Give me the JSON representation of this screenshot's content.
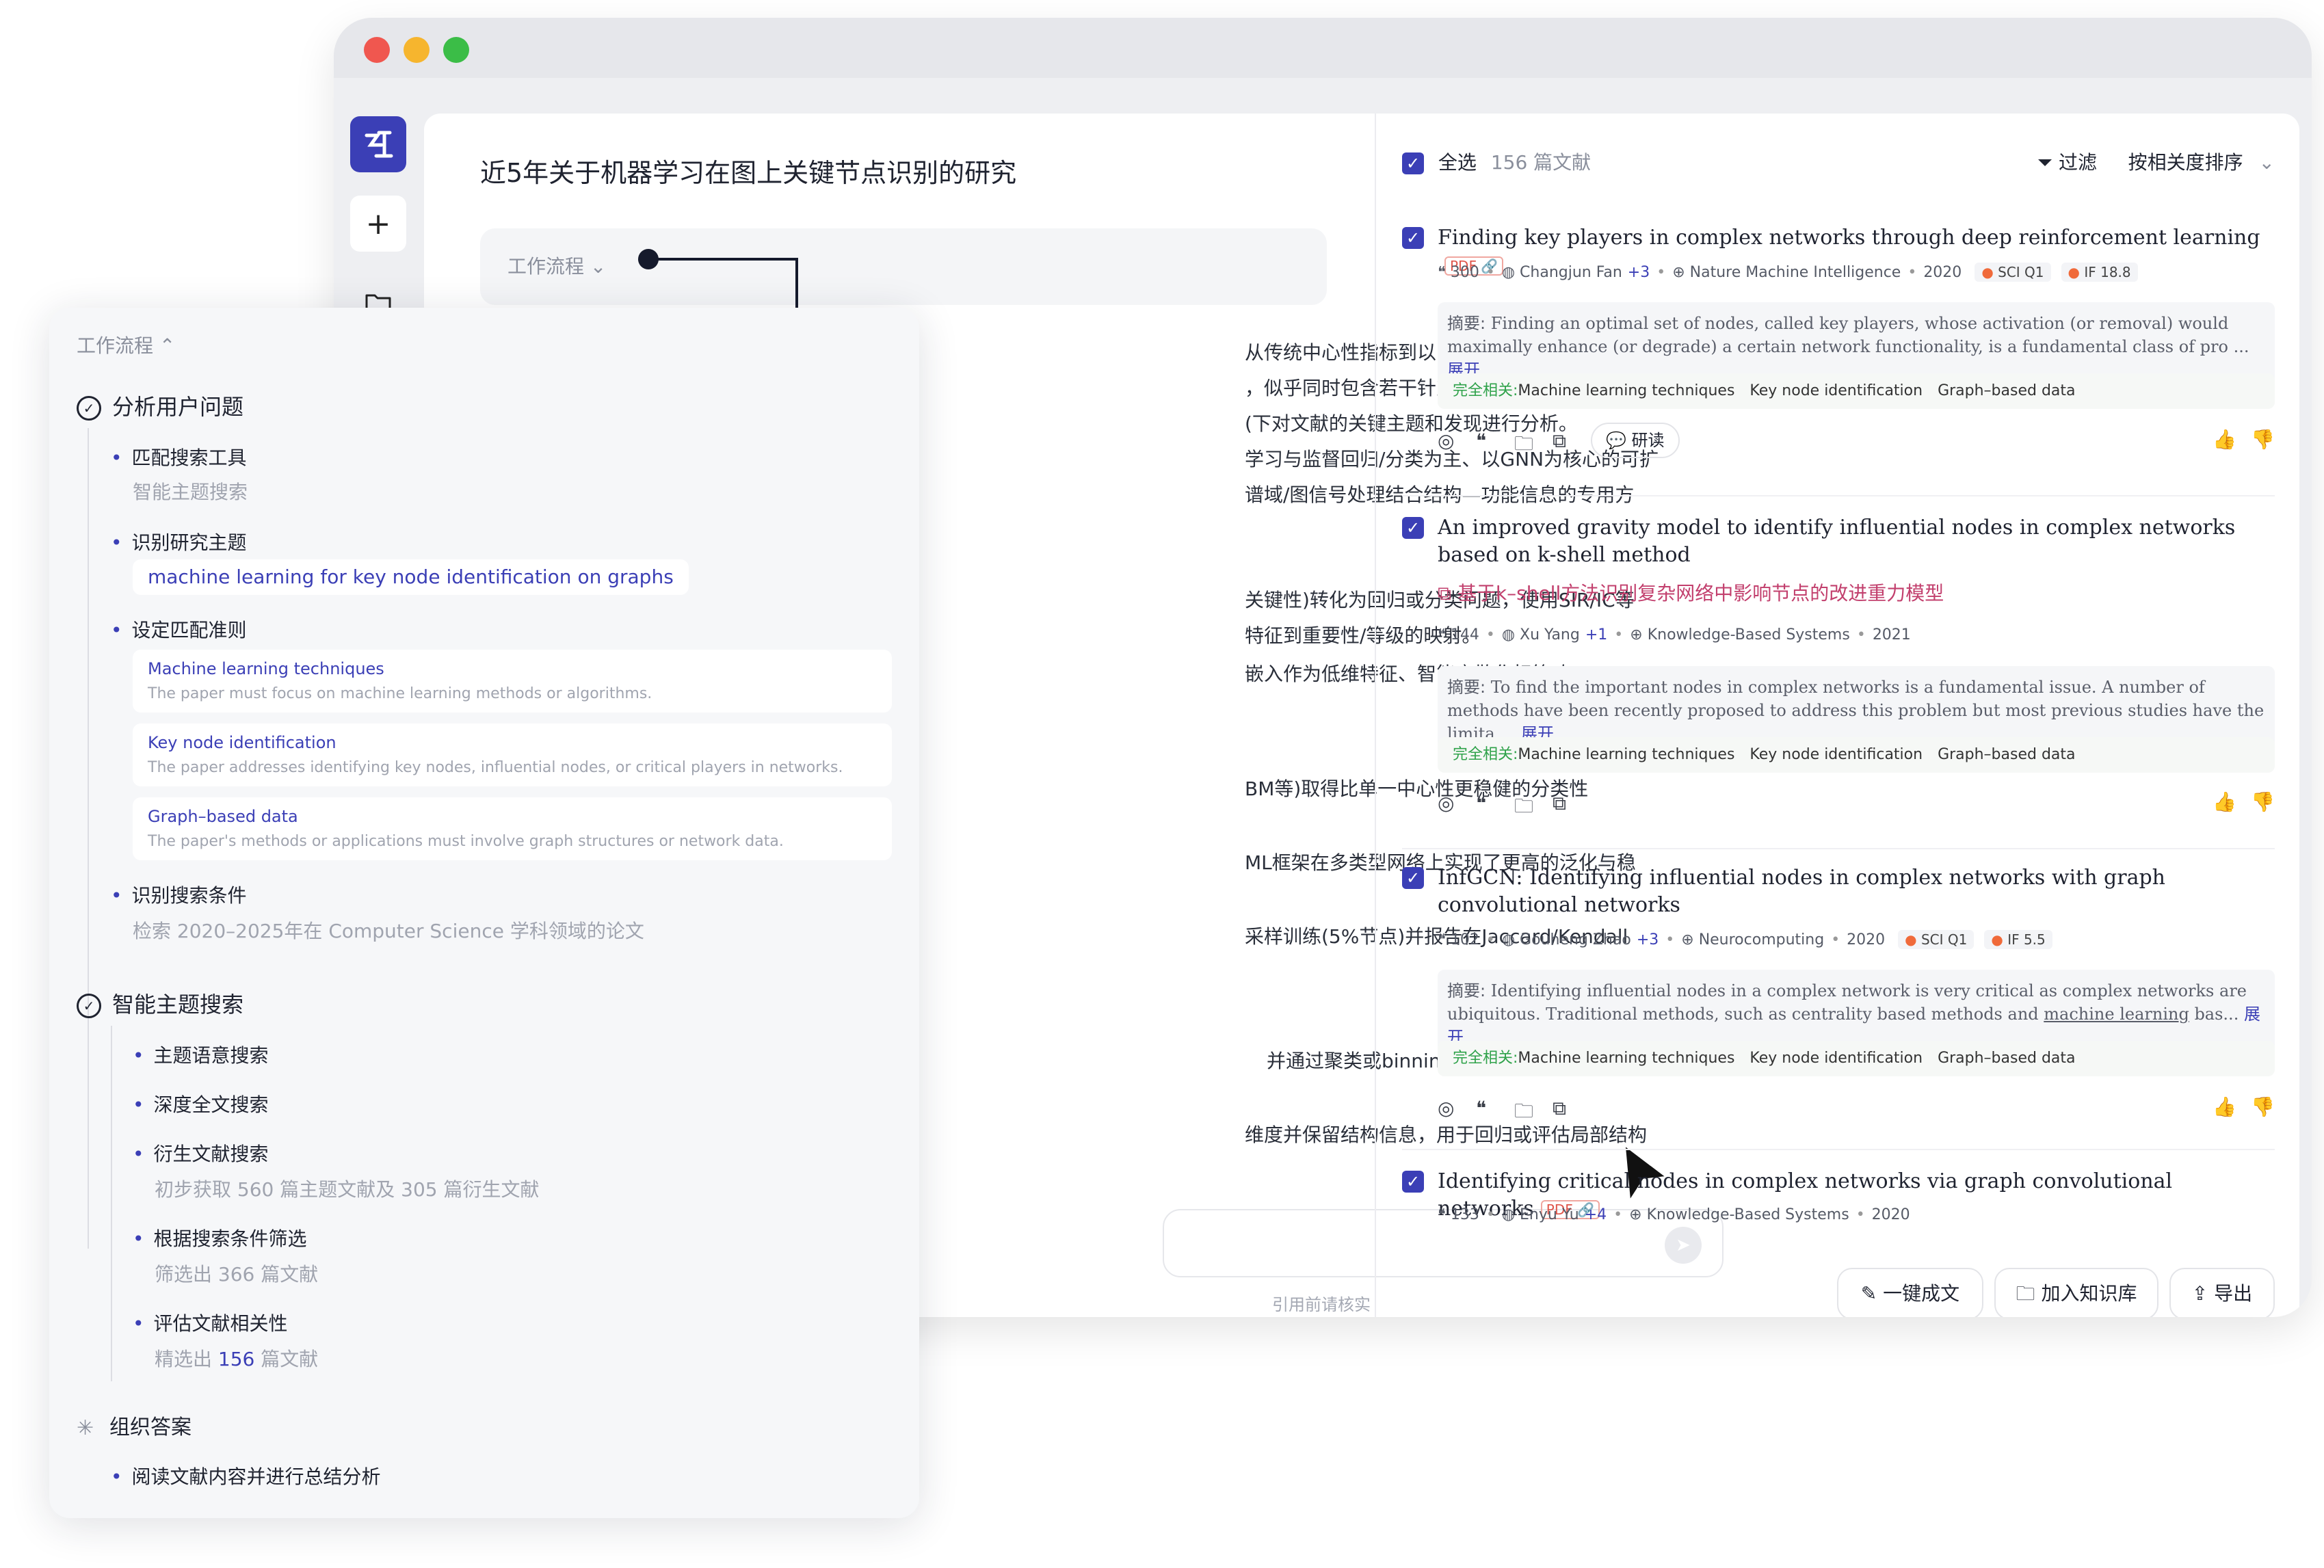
{
  "chat": {
    "title": "近5年关于机器学习在图上关键节点识别的研究",
    "workflow_label": "工作流程",
    "paragraphs": [
      "从传统中心性指标到以图神经网络、图表示学",
      "，似乎同时包含若干针对知识图谱、动态/大规",
      "(下对文献的关键主题和发现进行分析。",
      "学习与监督回归/分类为主、以GNN为核心的可扩",
      "谱域/图信号处理结合结构—功能信息的专用方",
      "关键性)转化为回归或分类问题，使用SIR/IC等",
      "特征到重要性/等级的映射。",
      "嵌入作为低维特征、智能离散化标签(如 Smart",
      "BM等)取得比单一中心性更稳健的分类性",
      "ML框架在多类型网络上实现了更高的泛化与稳",
      "采样训练(5%节点)并报告在Jaccard/Kendall",
      "并通过聚类或binning改进标签",
      "维度并保留结构信息，用于回归或评估局部结构"
    ],
    "paragraph_tail": "性",
    "disclaimer": "引用前请核实"
  },
  "results": {
    "select_all": "全选",
    "count": "156 篇文献",
    "filter_label": "过滤",
    "sort_label": "按相关度排序",
    "papers": [
      {
        "title": "Finding key players in complex networks through deep reinforcement learning",
        "pdf": "PDF",
        "citations": "300",
        "author": "Changjun Fan",
        "more_authors": "+3",
        "venue": "Nature Machine Intelligence",
        "year": "2020",
        "sci": "SCI Q1",
        "impact": "IF 18.8",
        "abstract_label": "摘要:",
        "abstract": "Finding an optimal set of nodes, called key players, whose activation (or removal) would maximally enhance (or degrade) a certain network functionality, is a fundamental class of pro ...",
        "expand": "展开",
        "relevance_label": "完全相关:",
        "tags": [
          "Machine learning techniques",
          "Key node identification",
          "Graph–based data"
        ],
        "read_label": "研读"
      },
      {
        "title": "An improved gravity model to identify influential nodes in complex networks based on k-shell method",
        "zh_title": "基于k–shell方法识别复杂网络中影响节点的改进重力模型",
        "citations": "144",
        "author": "Xu Yang",
        "more_authors": "+1",
        "venue": "Knowledge-Based Systems",
        "year": "2021",
        "abstract_label": "摘要:",
        "abstract": "To find the important nodes in complex networks is a fundamental issue. A number of methods have been recently proposed to address this problem but most previous studies have the limita ...",
        "expand": "展开",
        "relevance_label": "完全相关:",
        "tags": [
          "Machine learning techniques",
          "Key node identification",
          "Graph–based data"
        ]
      },
      {
        "title": "InfGCN: Identifying influential nodes in complex networks with graph convolutional networks",
        "citations": "102",
        "author": "Gouheng Zhao",
        "more_authors": "+3",
        "venue": "Neurocomputing",
        "year": "2020",
        "sci": "SCI Q1",
        "impact": "IF 5.5",
        "abstract_label": "摘要:",
        "abstract_a": "Identifying influential nodes in a complex network is very critical as complex networks are ubiquitous. Traditional methods, such as centrality based methods and ",
        "abstract_link": "machine learning",
        "abstract_b": " bas...",
        "expand": "展开",
        "relevance_label": "完全相关:",
        "tags": [
          "Machine learning techniques",
          "Key node identification",
          "Graph–based data"
        ]
      },
      {
        "title": "Identifying critical nodes in complex networks via graph convolutional networks",
        "pdf": "PDF",
        "citations": "133",
        "author": "Enyu Yu",
        "more_authors": "+4",
        "venue": "Knowledge-Based Systems",
        "year": "2020"
      }
    ],
    "bottom_buttons": [
      "一键成文",
      "加入知识库",
      "导出"
    ]
  },
  "workflow": {
    "header": "工作流程",
    "sections": [
      {
        "title": "分析用户问题",
        "items": [
          {
            "label": "匹配搜索工具",
            "sub": "智能主题搜索"
          },
          {
            "label": "识别研究主题",
            "chip": "machine learning for key node identification on graphs"
          },
          {
            "label": "设定匹配准则",
            "criteria": [
              {
                "title": "Machine learning techniques",
                "desc": "The paper must focus on machine learning methods or algorithms."
              },
              {
                "title": "Key node identification",
                "desc": "The paper addresses identifying key nodes, influential nodes, or critical players in networks."
              },
              {
                "title": "Graph–based data",
                "desc": "The paper's methods or applications must involve graph structures or network data."
              }
            ]
          },
          {
            "label": "识别搜索条件",
            "sub": "检索 2020–2025年在 Computer Science 学科领域的论文"
          }
        ]
      },
      {
        "title": "智能主题搜索",
        "items": [
          {
            "label": "主题语意搜索"
          },
          {
            "label": "深度全文搜索"
          },
          {
            "label": "衍生文献搜索",
            "sub": "初步获取 560 篇主题文献及 305 篇衍生文献"
          },
          {
            "label": "根据搜索条件筛选",
            "sub": "筛选出 366 篇文献"
          },
          {
            "label": "评估文献相关性",
            "sub_a": "精选出 ",
            "sub_hl": "156",
            "sub_b": " 篇文献"
          }
        ]
      },
      {
        "title": "组织答案",
        "items": [
          {
            "label": "阅读文献内容并进行总结分析"
          }
        ]
      }
    ]
  },
  "icons": [
    "sidebar-logo-icon",
    "plus-icon",
    "folder-icon",
    "chevron-down-icon",
    "chevron-up-icon",
    "send-icon",
    "filter-icon",
    "check-icon",
    "quote-icon",
    "user-icon",
    "venue-icon",
    "compass-icon",
    "folder-add-icon",
    "translate-icon",
    "chat-icon",
    "thumb-up-icon",
    "thumb-down-icon",
    "edit-icon",
    "export-icon",
    "spinner-icon",
    "pointer-cursor-icon"
  ],
  "colors": {
    "accent": "#3b3fb6",
    "relevance": "#2fa24a",
    "pdf": "#e0554a",
    "zh_title": "#c23f6d"
  }
}
